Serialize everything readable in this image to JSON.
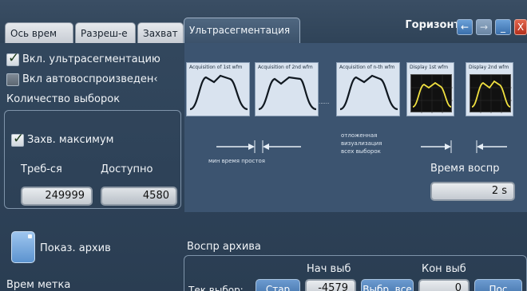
{
  "tabs": [
    {
      "label": "Ось врем",
      "active": false
    },
    {
      "label": "Разреш-е",
      "active": false
    },
    {
      "label": "Захват",
      "active": false
    },
    {
      "label": "Ультрасегментация",
      "active": true
    }
  ],
  "menu_title": "Горизонт",
  "window_buttons": {
    "back": "←",
    "forward": "→",
    "minimize": "_",
    "close": "X"
  },
  "options": {
    "enable_ultraseg": {
      "label": "Вкл. ультрасегментацию",
      "checked": true
    },
    "enable_autoplay": {
      "label": "Вкл автовоспроизведен‹",
      "checked": false
    }
  },
  "acquisitions": {
    "title": "Количество выборок",
    "capture_max": {
      "label": "Захв. максимум",
      "checked": true
    },
    "required_label": "Треб-ся",
    "required_value": "249999",
    "available_label": "Доступно",
    "available_value": "4580"
  },
  "diagram": {
    "captions": [
      "Acquisition of 1st wfm",
      "Acquisition of 2nd wfm",
      "Acquisition of n-th wfm",
      "Display 1st wfm",
      "Display 2nd wfm"
    ],
    "min_dead_time": "мин время простоя",
    "deferred_display": [
      "отложенная",
      "визуализация",
      "всех выборок"
    ],
    "play_time_label": "Время воспр",
    "play_time_value": "2 s"
  },
  "archive": {
    "show_label": "Показ. архив",
    "timestamp_label": "Врем метка",
    "playback_title": "Воспр архива",
    "start_label": "Нач выб",
    "end_label": "Кон выб",
    "current_label": "Тек выбор:",
    "start_button": "Стар",
    "start_value": "-4579",
    "select_all_button": "Выбр. все",
    "end_value": "0",
    "last_button": "Пос"
  },
  "colors": {
    "accent": "#4d82bf",
    "trace": "#f0e040",
    "background": "#2e4258"
  }
}
